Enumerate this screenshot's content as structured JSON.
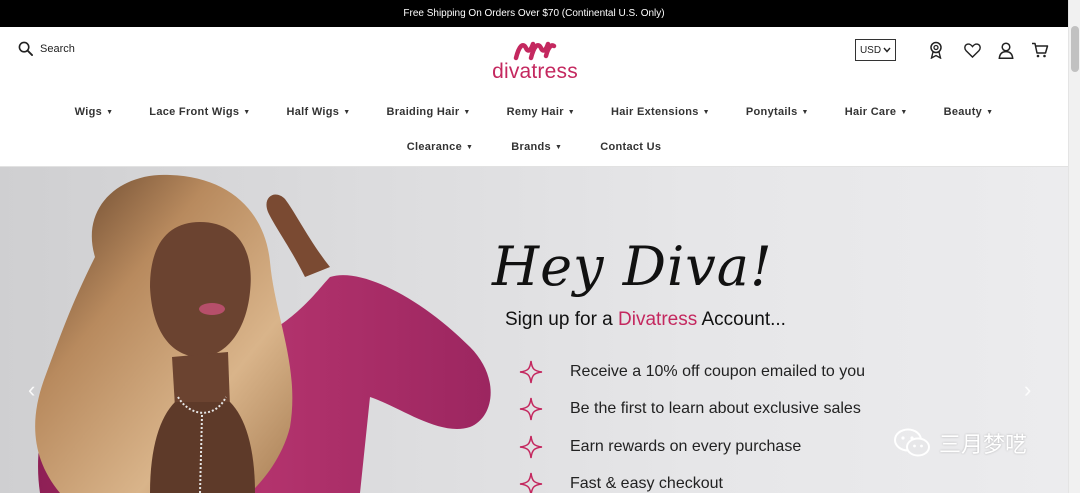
{
  "announcement": "Free Shipping On Orders Over $70 (Continental U.S. Only)",
  "search": {
    "label": "Search"
  },
  "logo": {
    "text": "divatress",
    "brand_color": "#c4285f"
  },
  "currency": {
    "selected": "USD"
  },
  "icons": [
    "rewards-icon",
    "wishlist-icon",
    "account-icon",
    "cart-icon"
  ],
  "nav": {
    "row1": [
      {
        "label": "Wigs"
      },
      {
        "label": "Lace Front Wigs"
      },
      {
        "label": "Half Wigs"
      },
      {
        "label": "Braiding Hair"
      },
      {
        "label": "Remy Hair"
      },
      {
        "label": "Hair Extensions"
      },
      {
        "label": "Ponytails"
      },
      {
        "label": "Hair Care"
      },
      {
        "label": "Beauty"
      }
    ],
    "row2": [
      {
        "label": "Clearance"
      },
      {
        "label": "Brands"
      },
      {
        "label": "Contact Us"
      }
    ],
    "caret": "▼"
  },
  "hero": {
    "title": "Hey Diva!",
    "subtitle_pre": "Sign up for a ",
    "subtitle_brand": "Divatress",
    "subtitle_post": " Account...",
    "benefits": [
      "Receive a 10% off coupon emailed to you",
      "Be the first to learn about exclusive sales",
      "Earn rewards on every purchase",
      "Fast & easy checkout"
    ],
    "prev": "‹",
    "next": "›"
  },
  "watermark": {
    "text": "三月梦呓"
  }
}
